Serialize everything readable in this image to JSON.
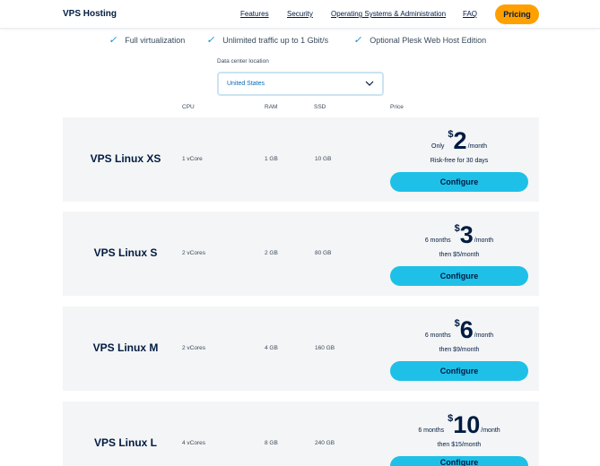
{
  "nav": {
    "brand": "VPS Hosting",
    "links": [
      "Features",
      "Security",
      "Operating Systems & Administration",
      "FAQ"
    ],
    "pricing": "Pricing"
  },
  "features": [
    "Full virtualization",
    "Unlimited traffic up to 1 Gbit/s",
    "Optional Plesk Web Host Edition"
  ],
  "datacenter": {
    "label": "Data center location",
    "value": "United States"
  },
  "columns": {
    "cpu": "CPU",
    "ram": "RAM",
    "ssd": "SSD",
    "price": "Price"
  },
  "plans": [
    {
      "name": "VPS Linux XS",
      "cpu": "1 vCore",
      "ram": "1 GB",
      "ssd": "10 GB",
      "prefix": "Only",
      "currency": "$",
      "amount": "2",
      "per": "/month",
      "sub": "Risk-free for 30 days",
      "cta": "Configure"
    },
    {
      "name": "VPS Linux S",
      "cpu": "2 vCores",
      "ram": "2 GB",
      "ssd": "80 GB",
      "prefix": "6  months",
      "currency": "$",
      "amount": "3",
      "per": "/month",
      "sub": "then $5/month",
      "cta": "Configure"
    },
    {
      "name": "VPS Linux M",
      "cpu": "2 vCores",
      "ram": "4 GB",
      "ssd": "160 GB",
      "prefix": "6  months",
      "currency": "$",
      "amount": "6",
      "per": "/month",
      "sub": "then $9/month",
      "cta": "Configure"
    },
    {
      "name": "VPS Linux L",
      "cpu": "4 vCores",
      "ram": "8 GB",
      "ssd": "240 GB",
      "prefix": "6  months",
      "currency": "$",
      "amount": "10",
      "per": "/month",
      "sub": "then $15/month",
      "cta": "Configure"
    }
  ],
  "icons": {
    "feature_check": "check-icon",
    "select_chevron": "chevron-down-icon"
  },
  "colors": {
    "accent_orange": "#ffa000",
    "accent_cyan": "#1ec0e8",
    "text_navy": "#001b41",
    "check_blue": "#0b8fd9"
  }
}
